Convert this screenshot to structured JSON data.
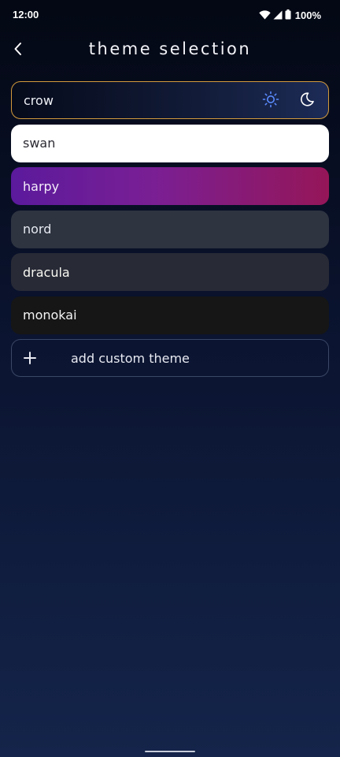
{
  "status_bar": {
    "time": "12:00",
    "battery": "100%",
    "icons": [
      "wifi-icon",
      "signal-icon",
      "battery-icon"
    ]
  },
  "header": {
    "back_icon": "chevron-left-icon",
    "title": "theme selection"
  },
  "themes": [
    {
      "label": "crow",
      "selected": true,
      "mode_icons": [
        "sun-icon",
        "moon-icon"
      ]
    },
    {
      "label": "swan"
    },
    {
      "label": "harpy"
    },
    {
      "label": "nord"
    },
    {
      "label": "dracula"
    },
    {
      "label": "monokai"
    }
  ],
  "add_custom": {
    "icon": "plus-icon",
    "label": "add custom theme"
  },
  "colors": {
    "accent_border": "#d39a3c",
    "sun_icon": "#5b8cff",
    "background_top": "#040814",
    "background_bottom": "#14244a"
  }
}
